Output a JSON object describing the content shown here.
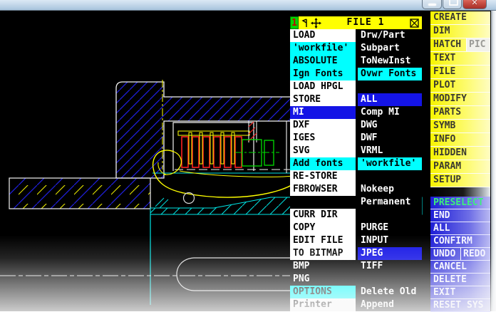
{
  "titlebar": {
    "buttons": [
      "minimize",
      "maximize",
      "close"
    ]
  },
  "menu": {
    "number_badge": "1",
    "title": "FILE 1",
    "rows": [
      {
        "left": {
          "label": "LOAD",
          "variant": "white"
        },
        "right": {
          "label": "Drw/Part",
          "variant": "black"
        }
      },
      {
        "left": {
          "label": "'workfile'",
          "variant": "cyan"
        },
        "right": {
          "label": "Subpart",
          "variant": "black"
        }
      },
      {
        "left": {
          "label": "ABSOLUTE",
          "variant": "cyan"
        },
        "right": {
          "label": "ToNewInst",
          "variant": "black"
        }
      },
      {
        "left": {
          "label": "Ign Fonts",
          "variant": "cyan"
        },
        "right": {
          "label": "Ovwr Fonts",
          "variant": "cyan"
        }
      },
      {
        "left": {
          "label": "LOAD HPGL",
          "variant": "white"
        },
        "right": {
          "label": "",
          "variant": "empty"
        }
      },
      {
        "left": {
          "label": "STORE",
          "variant": "white"
        },
        "right": {
          "label": "ALL",
          "variant": "blue"
        }
      },
      {
        "left": {
          "label": "MI",
          "variant": "blue"
        },
        "right": {
          "label": "Comp MI",
          "variant": "black"
        }
      },
      {
        "left": {
          "label": "DXF",
          "variant": "white"
        },
        "right": {
          "label": "DWG",
          "variant": "black"
        }
      },
      {
        "left": {
          "label": "IGES",
          "variant": "white"
        },
        "right": {
          "label": "DWF",
          "variant": "black"
        }
      },
      {
        "left": {
          "label": "SVG",
          "variant": "white"
        },
        "right": {
          "label": "VRML",
          "variant": "black"
        }
      },
      {
        "left": {
          "label": "Add fonts",
          "variant": "cyan"
        },
        "right": {
          "label": "'workfile'",
          "variant": "cyan"
        }
      },
      {
        "left": {
          "label": "RE-STORE",
          "variant": "white"
        },
        "right": {
          "label": "",
          "variant": "empty"
        }
      },
      {
        "left": {
          "label": "FBROWSER",
          "variant": "white"
        },
        "right": {
          "label": "Nokeep",
          "variant": "black"
        }
      },
      {
        "left": {
          "label": "",
          "variant": "empty"
        },
        "right": {
          "label": "Permanent",
          "variant": "black"
        }
      },
      {
        "left": {
          "label": "CURR DIR",
          "variant": "white"
        },
        "right": {
          "label": "",
          "variant": "empty"
        }
      },
      {
        "left": {
          "label": "COPY",
          "variant": "white"
        },
        "right": {
          "label": "PURGE",
          "variant": "black"
        }
      },
      {
        "left": {
          "label": "EDIT FILE",
          "variant": "white"
        },
        "right": {
          "label": "INPUT",
          "variant": "black"
        }
      },
      {
        "left": {
          "label": "TO BITMAP",
          "variant": "white"
        },
        "right": {
          "label": "JPEG",
          "variant": "blue"
        }
      },
      {
        "left": {
          "label": "BMP",
          "variant": "black"
        },
        "right": {
          "label": "TIFF",
          "variant": "black"
        }
      },
      {
        "left": {
          "label": "PNG",
          "variant": "black"
        },
        "right": {
          "label": "",
          "variant": "empty"
        }
      },
      {
        "left": {
          "label": "OPTIONS",
          "variant": "cyan"
        },
        "right": {
          "label": "Delete Old",
          "variant": "black"
        }
      },
      {
        "left": {
          "label": "Printer",
          "variant": "white"
        },
        "right": {
          "label": "Append",
          "variant": "black"
        }
      }
    ]
  },
  "sidebar": {
    "top_items": [
      {
        "label": "CREATE"
      },
      {
        "label": "DIM"
      },
      {
        "label": "HATCH",
        "extra": "PIC"
      },
      {
        "label": "TEXT"
      },
      {
        "label": "FILE"
      },
      {
        "label": "PLOT"
      },
      {
        "label": "MODIFY"
      },
      {
        "label": "PARTS"
      },
      {
        "label": "SYMB"
      },
      {
        "label": "INFO"
      },
      {
        "label": "HIDDEN"
      },
      {
        "label": "PARAM"
      },
      {
        "label": "SETUP"
      }
    ],
    "bottom_items": [
      {
        "label": "PRESELECT",
        "accent": true
      },
      {
        "label": "END"
      },
      {
        "label": "ALL"
      },
      {
        "label": "CONFIRM"
      },
      {
        "label": "UNDO",
        "extra": "REDO"
      },
      {
        "label": "CANCEL"
      },
      {
        "label": "DELETE"
      },
      {
        "label": "EXIT"
      },
      {
        "label": "RESET SYS"
      }
    ]
  },
  "colors": {
    "menu_header_yellow": "#FFFF00",
    "highlight_cyan": "#00FFFF",
    "highlight_blue": "#1414E6",
    "sidebar_yellow": "#F8F400",
    "sidebar_blue": "#1D1DD6",
    "preselect_text": "#3CF07C",
    "hatch_blue": "#2020E0",
    "hatch_cyan": "#00E0E0",
    "line_yellow": "#FFFF00",
    "line_red": "#FF2020",
    "line_green": "#00DD00"
  }
}
